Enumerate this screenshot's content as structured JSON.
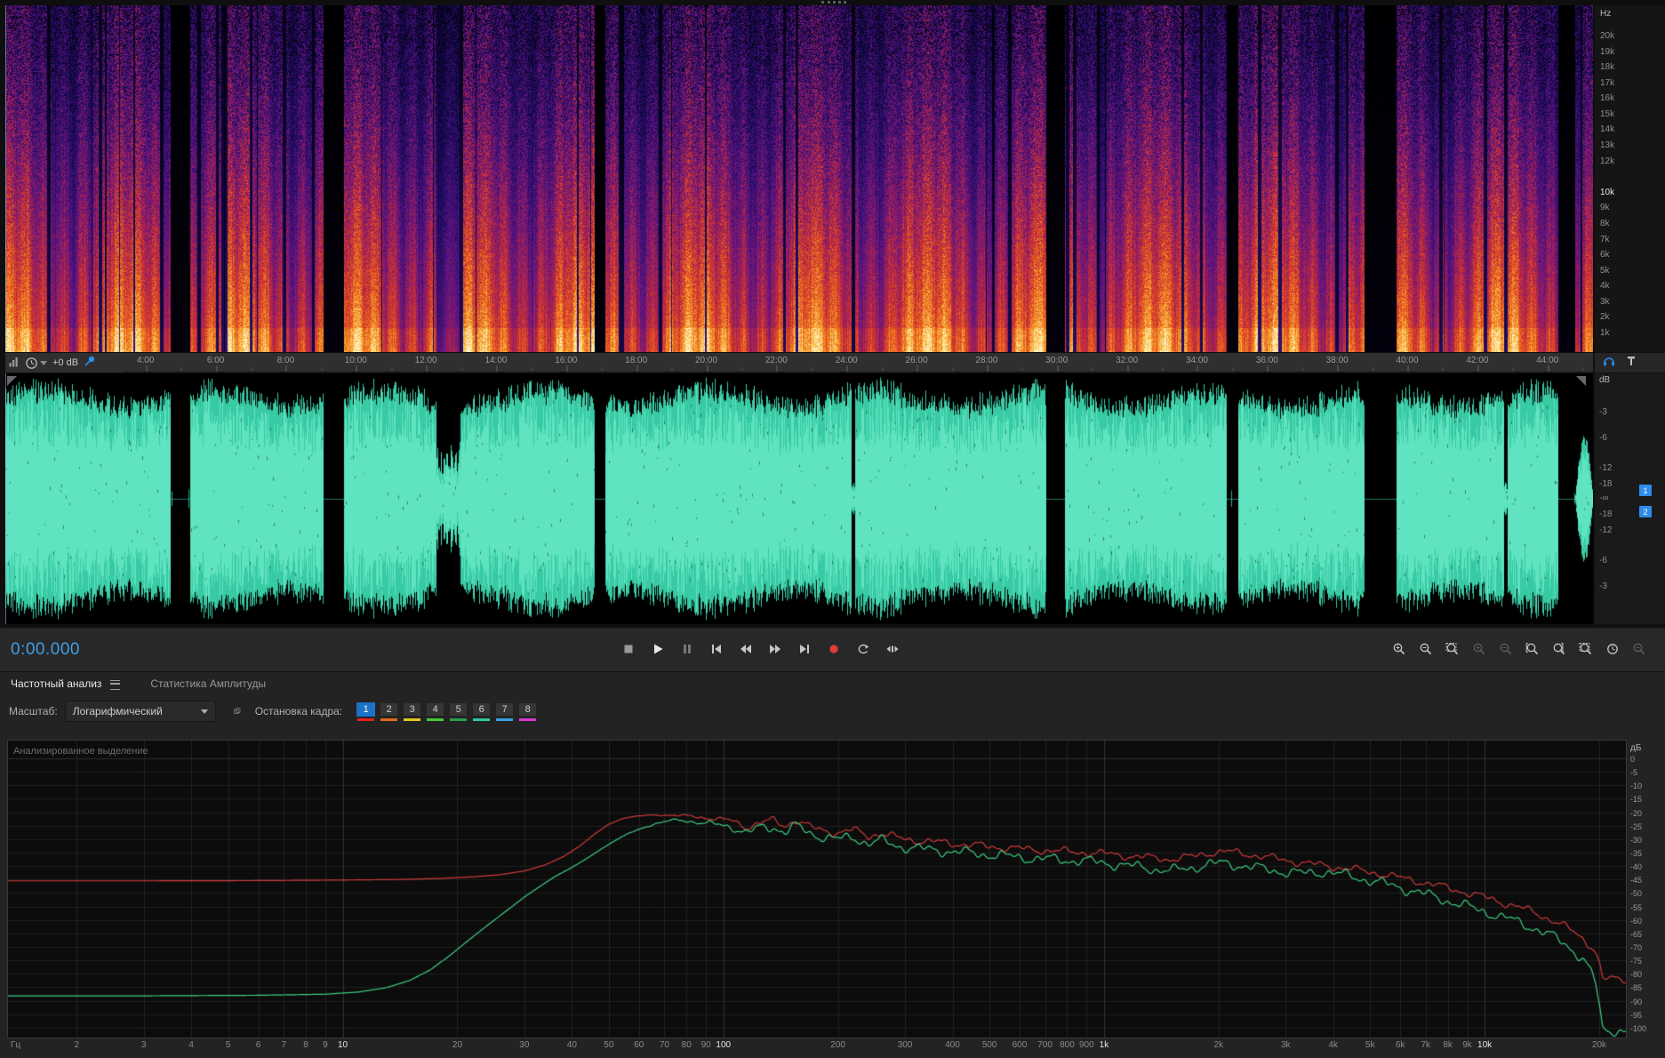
{
  "colors": {
    "accent_blue": "#2d8ceb",
    "waveform_teal": "#38caa4",
    "chart_red": "#d23b3b",
    "chart_green": "#3fcf82",
    "record_red": "#e23b3b"
  },
  "spectrogram": {
    "unit_label": "Hz",
    "freq_labels": [
      {
        "v": 20000,
        "label": "20k"
      },
      {
        "v": 19000,
        "label": "19k"
      },
      {
        "v": 18000,
        "label": "18k"
      },
      {
        "v": 17000,
        "label": "17k"
      },
      {
        "v": 16000,
        "label": "16k"
      },
      {
        "v": 15000,
        "label": "15k"
      },
      {
        "v": 14000,
        "label": "14k"
      },
      {
        "v": 13000,
        "label": "13k"
      },
      {
        "v": 12000,
        "label": "12k"
      },
      {
        "v": 10000,
        "label": "10k",
        "bright": true
      },
      {
        "v": 9000,
        "label": "9k"
      },
      {
        "v": 8000,
        "label": "8k"
      },
      {
        "v": 7000,
        "label": "7k"
      },
      {
        "v": 6000,
        "label": "6k"
      },
      {
        "v": 5000,
        "label": "5k"
      },
      {
        "v": 4000,
        "label": "4k"
      },
      {
        "v": 3000,
        "label": "3k"
      },
      {
        "v": 2000,
        "label": "2k"
      },
      {
        "v": 1000,
        "label": "1k"
      }
    ],
    "silence_regions": [
      [
        0.104,
        0.116
      ],
      [
        0.2,
        0.213
      ],
      [
        0.3707,
        0.3774
      ],
      [
        0.6555,
        0.6669
      ],
      [
        0.7688,
        0.7762
      ],
      [
        0.8559,
        0.876
      ],
      [
        0.9779,
        0.9886
      ]
    ],
    "quiet_regions": [
      [
        0.2715,
        0.2862,
        0.5
      ],
      [
        0.5329,
        0.5349,
        0.15
      ],
      [
        0.9437,
        0.9457,
        0.2
      ]
    ]
  },
  "timeline": {
    "visible_minutes": 45.3,
    "db_offset_label": "+0 dB",
    "labels": [
      {
        "min": 4,
        "label": "4:00"
      },
      {
        "min": 6,
        "label": "6:00"
      },
      {
        "min": 8,
        "label": "8:00"
      },
      {
        "min": 10,
        "label": "10:00"
      },
      {
        "min": 12,
        "label": "12:00"
      },
      {
        "min": 14,
        "label": "14:00"
      },
      {
        "min": 16,
        "label": "16:00"
      },
      {
        "min": 18,
        "label": "18:00"
      },
      {
        "min": 20,
        "label": "20:00"
      },
      {
        "min": 22,
        "label": "22:00"
      },
      {
        "min": 24,
        "label": "24:00"
      },
      {
        "min": 26,
        "label": "26:00"
      },
      {
        "min": 28,
        "label": "28:00"
      },
      {
        "min": 30,
        "label": "30:00"
      },
      {
        "min": 32,
        "label": "32:00"
      },
      {
        "min": 34,
        "label": "34:00"
      },
      {
        "min": 36,
        "label": "36:00"
      },
      {
        "min": 38,
        "label": "38:00"
      },
      {
        "min": 40,
        "label": "40:00"
      },
      {
        "min": 42,
        "label": "42:00"
      },
      {
        "min": 44,
        "label": "44:00"
      }
    ]
  },
  "waveform": {
    "unit_label": "dB",
    "levels": [
      -3,
      -6,
      -12,
      -18
    ],
    "center_label": "-∞",
    "channels": [
      "1",
      "2"
    ]
  },
  "transport": {
    "time": "0:00.000",
    "buttons": [
      {
        "name": "stop-button",
        "icon": "stop-icon"
      },
      {
        "name": "play-button",
        "icon": "play-icon"
      },
      {
        "name": "pause-button",
        "icon": "pause-icon"
      },
      {
        "name": "skip-to-start-button",
        "icon": "skip-start-icon"
      },
      {
        "name": "rewind-button",
        "icon": "rewind-icon"
      },
      {
        "name": "fast-forward-button",
        "icon": "fast-forward-icon"
      },
      {
        "name": "skip-to-end-button",
        "icon": "skip-end-icon"
      },
      {
        "name": "record-button",
        "icon": "record-icon"
      },
      {
        "name": "loop-playback-button",
        "icon": "loop-icon"
      },
      {
        "name": "skip-selection-button",
        "icon": "shuttle-icon"
      }
    ],
    "zoom_tools": [
      {
        "name": "zoom-in-time-button",
        "kind": "plus",
        "dim": false
      },
      {
        "name": "zoom-out-time-button",
        "kind": "minus",
        "dim": false
      },
      {
        "name": "zoom-to-selection-button",
        "kind": "box",
        "dim": false
      },
      {
        "name": "zoom-in-amplitude-button",
        "kind": "plus",
        "dim": true
      },
      {
        "name": "zoom-out-amplitude-button",
        "kind": "minus",
        "dim": true
      },
      {
        "name": "zoom-in-left-edge-button",
        "kind": "bracket-left",
        "dim": false
      },
      {
        "name": "zoom-in-right-edge-button",
        "kind": "bracket-right",
        "dim": false
      },
      {
        "name": "zoom-selection-full-button",
        "kind": "box",
        "dim": false
      },
      {
        "name": "timed-record-button",
        "kind": "clock",
        "dim": false
      },
      {
        "name": "zoom-out-full-button",
        "kind": "minus",
        "dim": true
      }
    ]
  },
  "analysis": {
    "tabs": [
      {
        "label": "Частотный анализ",
        "active": true
      },
      {
        "label": "Статистика Амплитуды",
        "active": false
      }
    ],
    "scale_label": "Масштаб:",
    "scale_value": "Логарифмический",
    "hold_label": "Остановка кадра:",
    "hold_buttons": [
      {
        "n": "1",
        "color": "#e02020",
        "selected": true
      },
      {
        "n": "2",
        "color": "#e06820",
        "selected": false
      },
      {
        "n": "3",
        "color": "#e0c820",
        "selected": false
      },
      {
        "n": "4",
        "color": "#48c838",
        "selected": false
      },
      {
        "n": "5",
        "color": "#28a048",
        "selected": false
      },
      {
        "n": "6",
        "color": "#30c8a0",
        "selected": false
      },
      {
        "n": "7",
        "color": "#38a0e0",
        "selected": false
      },
      {
        "n": "8",
        "color": "#d838d0",
        "selected": false
      }
    ]
  },
  "chart_data": {
    "type": "line",
    "annotation": "Анализированное выделение",
    "x_axis": {
      "unit": "Гц",
      "scale": "log",
      "min": 1.32,
      "max": 23500,
      "ticks": [
        {
          "f": 2,
          "label": "2"
        },
        {
          "f": 3,
          "label": "3"
        },
        {
          "f": 4,
          "label": "4"
        },
        {
          "f": 5,
          "label": "5"
        },
        {
          "f": 6,
          "label": "6"
        },
        {
          "f": 7,
          "label": "7"
        },
        {
          "f": 8,
          "label": "8"
        },
        {
          "f": 9,
          "label": "9"
        },
        {
          "f": 10,
          "label": "10",
          "bright": true
        },
        {
          "f": 20,
          "label": "20"
        },
        {
          "f": 30,
          "label": "30"
        },
        {
          "f": 40,
          "label": "40"
        },
        {
          "f": 50,
          "label": "50"
        },
        {
          "f": 60,
          "label": "60"
        },
        {
          "f": 70,
          "label": "70"
        },
        {
          "f": 80,
          "label": "80"
        },
        {
          "f": 90,
          "label": "90"
        },
        {
          "f": 100,
          "label": "100",
          "bright": true
        },
        {
          "f": 200,
          "label": "200"
        },
        {
          "f": 300,
          "label": "300"
        },
        {
          "f": 400,
          "label": "400"
        },
        {
          "f": 500,
          "label": "500"
        },
        {
          "f": 600,
          "label": "600"
        },
        {
          "f": 700,
          "label": "700"
        },
        {
          "f": 800,
          "label": "800"
        },
        {
          "f": 900,
          "label": "900"
        },
        {
          "f": 1000,
          "label": "1k",
          "bright": true
        },
        {
          "f": 2000,
          "label": "2k"
        },
        {
          "f": 3000,
          "label": "3k"
        },
        {
          "f": 4000,
          "label": "4k"
        },
        {
          "f": 5000,
          "label": "5k"
        },
        {
          "f": 6000,
          "label": "6k"
        },
        {
          "f": 7000,
          "label": "7k"
        },
        {
          "f": 8000,
          "label": "8k"
        },
        {
          "f": 9000,
          "label": "9k"
        },
        {
          "f": 10000,
          "label": "10k",
          "bright": true
        },
        {
          "f": 20000,
          "label": "20k"
        }
      ]
    },
    "y_axis": {
      "unit": "дБ",
      "max": 0,
      "min": -100,
      "tick_step": 5
    },
    "series": [
      {
        "name": "hold-1",
        "color": "#d23b3b",
        "points": [
          [
            1.3,
            -45.5
          ],
          [
            3,
            -45.5
          ],
          [
            6,
            -45.4
          ],
          [
            10,
            -45.2
          ],
          [
            14,
            -45.0
          ],
          [
            18,
            -44.6
          ],
          [
            22,
            -44.0
          ],
          [
            26,
            -43.2
          ],
          [
            30,
            -41.8
          ],
          [
            34,
            -39.6
          ],
          [
            38,
            -36.5
          ],
          [
            42,
            -32.5
          ],
          [
            46,
            -28.0
          ],
          [
            50,
            -24.5
          ],
          [
            54,
            -22.5
          ],
          [
            58,
            -21.6
          ],
          [
            64,
            -21.1
          ],
          [
            70,
            -21.0
          ],
          [
            78,
            -21.3
          ],
          [
            86,
            -21.8
          ],
          [
            95,
            -22.3
          ],
          [
            105,
            -23.2
          ],
          [
            115,
            -25.5
          ],
          [
            125,
            -23.8
          ],
          [
            135,
            -23.2
          ],
          [
            145,
            -25.0
          ],
          [
            155,
            -22.8
          ],
          [
            170,
            -25.8
          ],
          [
            185,
            -26.8
          ],
          [
            200,
            -27.6
          ],
          [
            220,
            -26.6
          ],
          [
            240,
            -28.8
          ],
          [
            260,
            -27.8
          ],
          [
            285,
            -29.5
          ],
          [
            310,
            -30.2
          ],
          [
            340,
            -30.8
          ],
          [
            370,
            -31.2
          ],
          [
            400,
            -31.6
          ],
          [
            450,
            -32.2
          ],
          [
            500,
            -32.8
          ],
          [
            560,
            -33.2
          ],
          [
            630,
            -33.8
          ],
          [
            710,
            -34.2
          ],
          [
            800,
            -34.6
          ],
          [
            900,
            -35.0
          ],
          [
            1000,
            -35.4
          ],
          [
            1150,
            -36.2
          ],
          [
            1300,
            -36.8
          ],
          [
            1500,
            -37.4
          ],
          [
            1700,
            -36.6
          ],
          [
            1900,
            -35.0
          ],
          [
            2100,
            -34.6
          ],
          [
            2400,
            -35.6
          ],
          [
            2700,
            -36.8
          ],
          [
            3000,
            -37.8
          ],
          [
            3400,
            -39.0
          ],
          [
            3800,
            -39.8
          ],
          [
            4300,
            -40.8
          ],
          [
            4800,
            -41.8
          ],
          [
            5400,
            -43.0
          ],
          [
            6000,
            -44.4
          ],
          [
            6800,
            -45.8
          ],
          [
            7600,
            -47.4
          ],
          [
            8500,
            -49.0
          ],
          [
            9500,
            -50.8
          ],
          [
            10500,
            -52.4
          ],
          [
            12000,
            -54.8
          ],
          [
            13500,
            -57.2
          ],
          [
            15000,
            -60.0
          ],
          [
            16500,
            -63.0
          ],
          [
            18000,
            -66.5
          ],
          [
            19000,
            -69.5
          ],
          [
            19600,
            -72.0
          ],
          [
            20000,
            -76.0
          ],
          [
            20400,
            -82.0
          ]
        ]
      },
      {
        "name": "current",
        "color": "#3fcf82",
        "points": [
          [
            1.3,
            -88.2
          ],
          [
            3,
            -88.2
          ],
          [
            6,
            -88.0
          ],
          [
            9,
            -87.6
          ],
          [
            11,
            -86.8
          ],
          [
            13,
            -85.2
          ],
          [
            15,
            -82.5
          ],
          [
            17,
            -78.5
          ],
          [
            19,
            -73.5
          ],
          [
            21,
            -68.5
          ],
          [
            24,
            -62.0
          ],
          [
            27,
            -56.5
          ],
          [
            30,
            -51.5
          ],
          [
            33,
            -47.5
          ],
          [
            36,
            -44.0
          ],
          [
            40,
            -40.5
          ],
          [
            44,
            -37.0
          ],
          [
            48,
            -33.5
          ],
          [
            52,
            -30.5
          ],
          [
            56,
            -28.0
          ],
          [
            61,
            -26.0
          ],
          [
            66,
            -24.3
          ],
          [
            72,
            -23.2
          ],
          [
            78,
            -23.0
          ],
          [
            85,
            -23.6
          ],
          [
            95,
            -24.6
          ],
          [
            105,
            -25.4
          ],
          [
            115,
            -27.6
          ],
          [
            125,
            -26.0
          ],
          [
            135,
            -25.4
          ],
          [
            145,
            -27.2
          ],
          [
            155,
            -25.2
          ],
          [
            170,
            -28.0
          ],
          [
            185,
            -29.2
          ],
          [
            200,
            -30.2
          ],
          [
            220,
            -29.2
          ],
          [
            240,
            -31.6
          ],
          [
            260,
            -30.6
          ],
          [
            285,
            -32.4
          ],
          [
            310,
            -33.2
          ],
          [
            340,
            -33.8
          ],
          [
            370,
            -34.2
          ],
          [
            400,
            -34.6
          ],
          [
            450,
            -35.2
          ],
          [
            500,
            -35.8
          ],
          [
            560,
            -36.4
          ],
          [
            630,
            -37.0
          ],
          [
            710,
            -37.4
          ],
          [
            800,
            -37.8
          ],
          [
            900,
            -38.2
          ],
          [
            1000,
            -38.8
          ],
          [
            1150,
            -39.8
          ],
          [
            1300,
            -40.8
          ],
          [
            1500,
            -41.8
          ],
          [
            1700,
            -40.6
          ],
          [
            1900,
            -39.2
          ],
          [
            2100,
            -39.0
          ],
          [
            2400,
            -40.2
          ],
          [
            2700,
            -41.4
          ],
          [
            3000,
            -42.2
          ],
          [
            3400,
            -42.8
          ],
          [
            3800,
            -42.0
          ],
          [
            4300,
            -43.4
          ],
          [
            4800,
            -44.8
          ],
          [
            5400,
            -46.4
          ],
          [
            6000,
            -48.0
          ],
          [
            6800,
            -50.0
          ],
          [
            7600,
            -52.0
          ],
          [
            8500,
            -54.0
          ],
          [
            9500,
            -56.0
          ],
          [
            10500,
            -57.8
          ],
          [
            12000,
            -60.4
          ],
          [
            13500,
            -63.0
          ],
          [
            15000,
            -66.0
          ],
          [
            16500,
            -69.5
          ],
          [
            18000,
            -74.0
          ],
          [
            19000,
            -79.0
          ],
          [
            19600,
            -84.0
          ],
          [
            20000,
            -92.0
          ],
          [
            20400,
            -101.0
          ]
        ]
      }
    ]
  }
}
